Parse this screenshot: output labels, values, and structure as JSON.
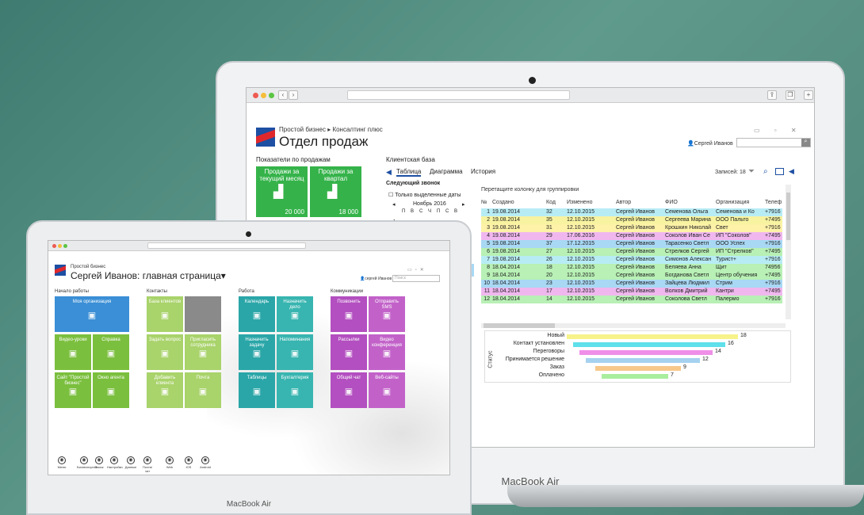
{
  "right_laptop": {
    "brand": "MacBook Air",
    "breadcrumb": {
      "root": "Простой бизнес",
      "sep": "▸",
      "leaf": "Консалтинг плюс"
    },
    "page_title": "Отдел продаж",
    "user": "Сергей Иванов",
    "kpi_title": "Показатели по продажам",
    "kpi": [
      {
        "label": "Продажи за текущий месяц",
        "value": "20 000"
      },
      {
        "label": "Продажи за квартал",
        "value": "18 000"
      }
    ],
    "base_title": "Клиентская база",
    "tabs": [
      "Таблица",
      "Диаграмма",
      "История"
    ],
    "next_call": "Следующий звонок",
    "only_selected": "Только выделенные даты",
    "calendar": {
      "month": "Ноябрь 2016",
      "days": [
        "П",
        "В",
        "С",
        "Ч",
        "П",
        "С",
        "В"
      ]
    },
    "records": "Записей: 18",
    "group_hint": "Перетащите колонку для группировки",
    "columns": [
      "№",
      "Создано",
      "Код",
      "Изменено",
      "Автор",
      "ФИО",
      "Организация",
      "Телеф"
    ],
    "rows": [
      [
        "1",
        "19.08.2014",
        "32",
        "12.10.2015",
        "Сергей Иванов",
        "Семенова Ольга",
        "Семенова и Ко",
        "+7916"
      ],
      [
        "2",
        "19.08.2014",
        "35",
        "12.10.2015",
        "Сергей Иванов",
        "Сергеева Марина",
        "ООО Пальто",
        "+7495"
      ],
      [
        "3",
        "19.08.2014",
        "31",
        "12.10.2015",
        "Сергей Иванов",
        "Крошкин Николай",
        "Свет",
        "+7916"
      ],
      [
        "4",
        "19.08.2014",
        "29",
        "17.06.2016",
        "Сергей Иванов",
        "Соколов Иван Се",
        "ИП \"Соколов\"",
        "+7495"
      ],
      [
        "5",
        "19.08.2014",
        "37",
        "17.12.2015",
        "Сергей Иванов",
        "Тарасенко Светл",
        "ООО Успех",
        "+7916"
      ],
      [
        "6",
        "19.08.2014",
        "27",
        "12.10.2015",
        "Сергей Иванов",
        "Стрелков Сергей",
        "ИП \"Стрелков\"",
        "+7495"
      ],
      [
        "7",
        "19.08.2014",
        "26",
        "12.10.2015",
        "Сергей Иванов",
        "Симонов Алексан",
        "Турист+",
        "+7916"
      ],
      [
        "8",
        "18.04.2014",
        "18",
        "12.10.2015",
        "Сергей Иванов",
        "Беляева Анна",
        "Щит",
        "74956"
      ],
      [
        "9",
        "18.04.2014",
        "20",
        "12.10.2015",
        "Сергей Иванов",
        "Богданова Светл",
        "Центр обучения",
        "+7495"
      ],
      [
        "10",
        "18.04.2014",
        "23",
        "12.10.2015",
        "Сергей Иванов",
        "Зайцева Людмил",
        "Стрим",
        "+7916"
      ],
      [
        "11",
        "18.04.2014",
        "17",
        "12.10.2015",
        "Сергей Иванов",
        "Волков Дмитрий",
        "Кантри",
        "+7495"
      ],
      [
        "12",
        "18.04.2014",
        "14",
        "12.10.2015",
        "Сергей Иванов",
        "Соколова Светл",
        "Палермо",
        "+7916"
      ]
    ],
    "row_colors": [
      "#b7ecf5",
      "#f7f3a0",
      "#fdf2a8",
      "#f0b7ef",
      "#a8d8f4",
      "#b8f0b5",
      "#b7ecf5",
      "#b8f0b5",
      "#b8f0b5",
      "#a8d8f4",
      "#f0b7ef",
      "#b8f0b5"
    ],
    "chart_data": {
      "type": "bar",
      "ylabel": "Статус",
      "categories": [
        "Новый",
        "Контакт установлен",
        "Переговоры",
        "Принимается решение",
        "Заказ",
        "Оплачено"
      ],
      "values": [
        18,
        16,
        14,
        12,
        9,
        7
      ],
      "colors": [
        "#f7f38a",
        "#5fe0ea",
        "#ef8fe8",
        "#a6d2f0",
        "#f7c88a",
        "#a9ee9e"
      ]
    }
  },
  "left_laptop": {
    "brand": "MacBook Air",
    "app": "Простой бизнес",
    "title": "Сергей Иванов: главная страница",
    "user": "сергей Иванов",
    "search_placeholder": "Поиск",
    "groups": [
      "Начало работы",
      "Контакты",
      "Работа",
      "Коммуникации"
    ],
    "tiles": {
      "start": [
        "Моя организация",
        "Видео-уроки",
        "Справка",
        "Сайт \"Простой бизнес\"",
        "Окно агента"
      ],
      "contacts": [
        "База клиентов",
        "Пригласить сотрудника",
        "Задать вопрос",
        "Добавить клиента",
        "Почта"
      ],
      "work": [
        "Календарь",
        "Назначить дело",
        "Назначить задачу",
        "Напоминания",
        "Таблицы",
        "Бухгалтерия"
      ],
      "comm": [
        "Позвонить",
        "Отправить SMS",
        "Рассылки",
        "Видео конференция",
        "Общий чат",
        "Веб-сайты"
      ]
    },
    "bottom": [
      "Меню",
      "Бизнеспортал",
      "Поиск",
      "Настройки",
      "Данные",
      "Почта/чат",
      "Web",
      "iOS",
      "Android"
    ],
    "colors": {
      "blue": "#3a8fd6",
      "green": "#7bbf3e",
      "lgreen": "#a9d36b",
      "teal": "#2aa6a8",
      "cyan": "#38b5b0",
      "purple": "#b34fc0",
      "pink": "#c262c9"
    }
  }
}
